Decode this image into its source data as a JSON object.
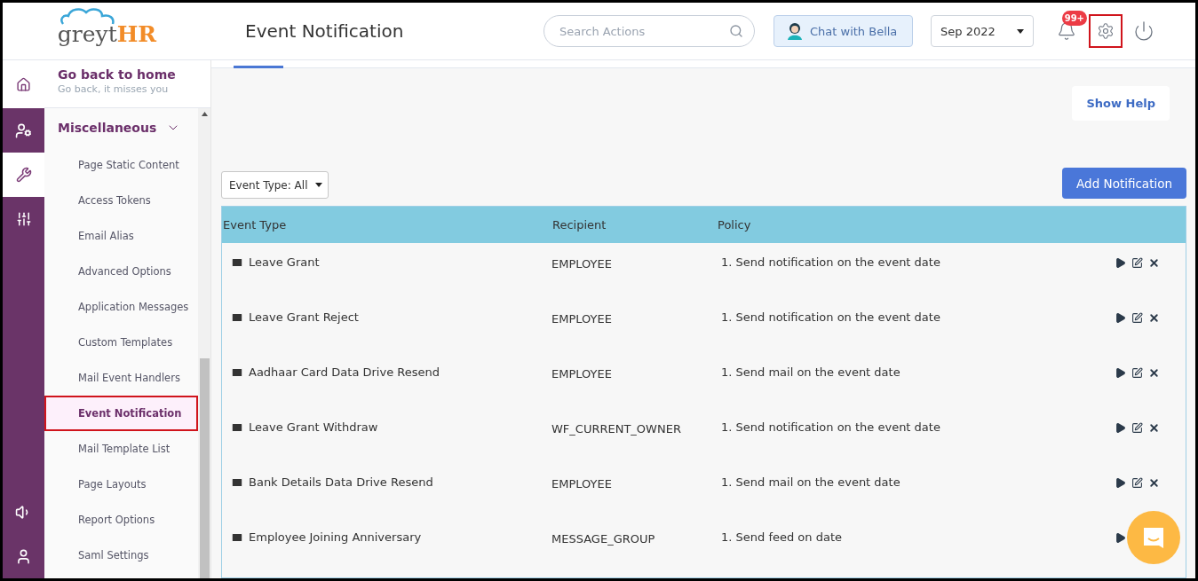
{
  "header": {
    "logo_left": "greyt",
    "logo_right": "HR",
    "title": "Event Notification",
    "search": {
      "placeholder": "Search Actions"
    },
    "chat_button": "Chat with Bella",
    "period": "Sep 2022",
    "notification_badge": "99+"
  },
  "rail": [
    {
      "kind": "user-gear",
      "selected": false
    },
    {
      "kind": "wrench",
      "selected": true
    },
    {
      "kind": "sliders",
      "selected": false
    },
    {
      "kind": "speaker",
      "selected": false
    },
    {
      "kind": "user",
      "selected": false
    }
  ],
  "home_link": {
    "title": "Go back to home",
    "subtitle": "Go back, it misses you"
  },
  "section": {
    "title": "Miscellaneous",
    "expanded": true
  },
  "nav_items": [
    {
      "label": "Page Static Content",
      "selected": false
    },
    {
      "label": "Access Tokens",
      "selected": false
    },
    {
      "label": "Email Alias",
      "selected": false
    },
    {
      "label": "Advanced Options",
      "selected": false
    },
    {
      "label": "Application Messages",
      "selected": false
    },
    {
      "label": "Custom Templates",
      "selected": false
    },
    {
      "label": "Mail Event Handlers",
      "selected": false
    },
    {
      "label": "Event Notification",
      "selected": true
    },
    {
      "label": "Mail Template List",
      "selected": false
    },
    {
      "label": "Page Layouts",
      "selected": false
    },
    {
      "label": "Report Options",
      "selected": false
    },
    {
      "label": "Saml Settings",
      "selected": false
    }
  ],
  "show_help": "Show Help",
  "filter": "Event Type: All",
  "add_button": "Add Notification",
  "table": {
    "columns": [
      "Event Type",
      "Recipient",
      "Policy"
    ],
    "rows": [
      {
        "event": "Leave Grant",
        "recipient": "EMPLOYEE",
        "policy": "1. Send notification on the event date"
      },
      {
        "event": "Leave Grant Reject",
        "recipient": "EMPLOYEE",
        "policy": "1. Send notification on the event date"
      },
      {
        "event": "Aadhaar Card Data Drive Resend",
        "recipient": "EMPLOYEE",
        "policy": "1. Send mail on the event date"
      },
      {
        "event": "Leave Grant Withdraw",
        "recipient": "WF_CURRENT_OWNER",
        "policy": "1. Send notification on the event date"
      },
      {
        "event": "Bank Details Data Drive Resend",
        "recipient": "EMPLOYEE",
        "policy": "1. Send mail on the event date"
      },
      {
        "event": "Employee Joining Anniversary",
        "recipient": "MESSAGE_GROUP",
        "policy": "1. Send feed on date"
      }
    ]
  }
}
